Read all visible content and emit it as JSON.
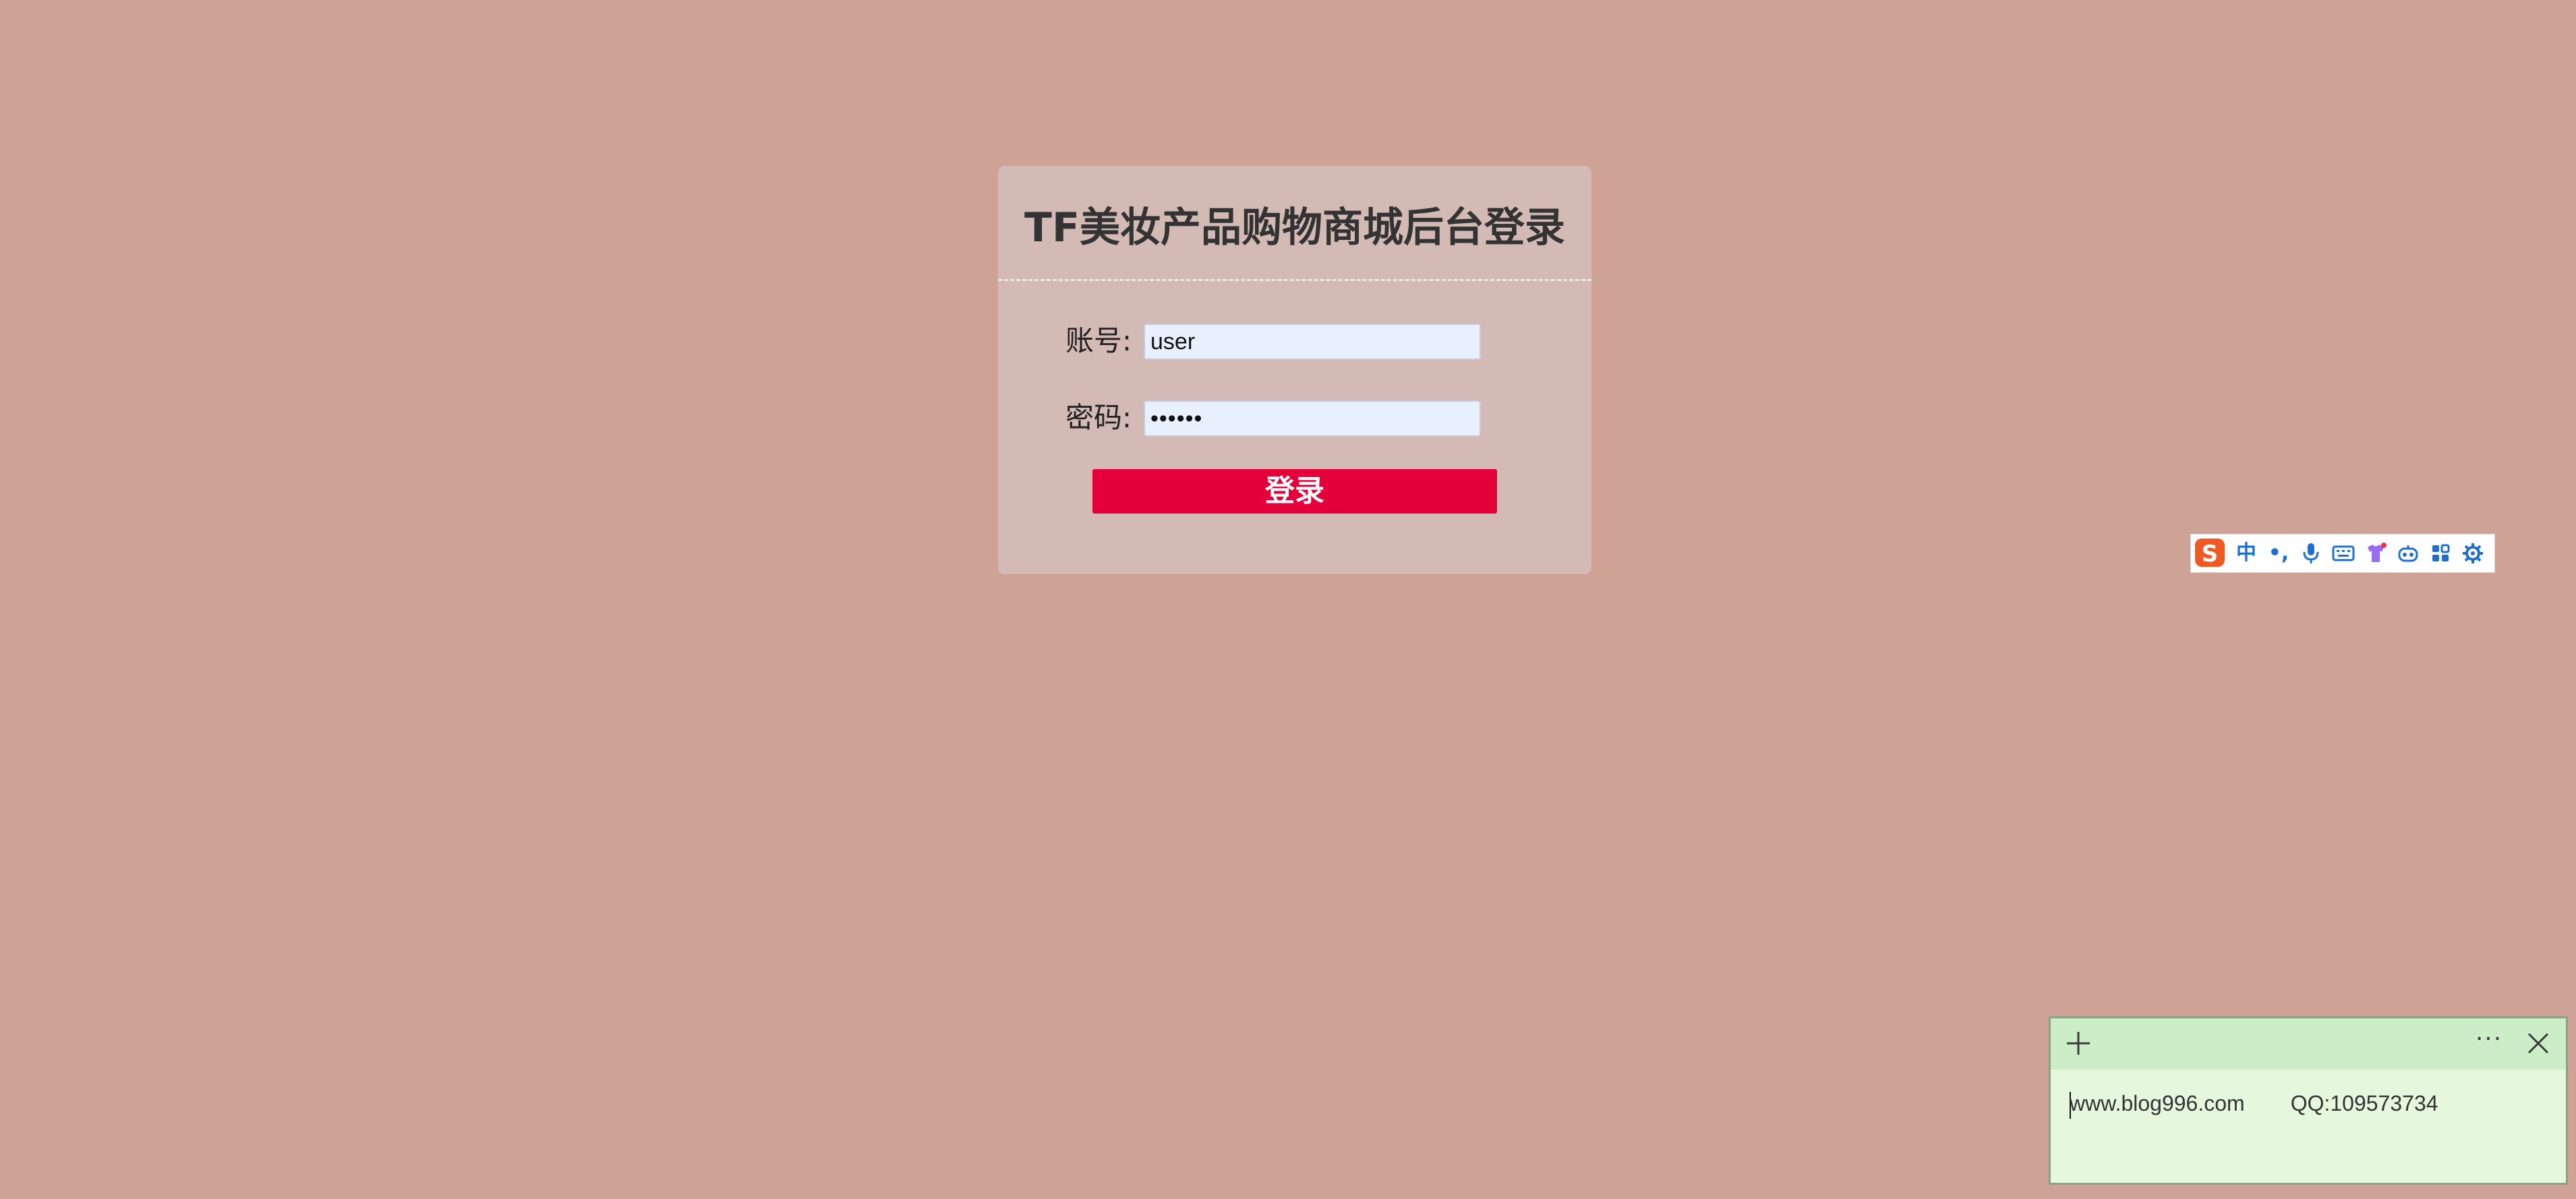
{
  "login": {
    "title": "TF美妆产品购物商城后台登录",
    "account_label": "账号:",
    "account_value": "user",
    "password_label": "密码:",
    "password_value": "••••••",
    "submit_label": "登录"
  },
  "ime_toolbar": {
    "logo": "S",
    "items": [
      {
        "icon": "chinese-mode-icon",
        "label": "中"
      },
      {
        "icon": "punctuation-icon",
        "label": "•,"
      },
      {
        "icon": "microphone-icon",
        "label": ""
      },
      {
        "icon": "keyboard-icon",
        "label": ""
      },
      {
        "icon": "skin-shirt-icon",
        "label": ""
      },
      {
        "icon": "robot-icon",
        "label": ""
      },
      {
        "icon": "apps-grid-icon",
        "label": ""
      },
      {
        "icon": "settings-icon",
        "label": ""
      }
    ]
  },
  "sticky_note": {
    "more_label": "···",
    "line_website": "www.blog996.com",
    "line_qq": "QQ:109573734"
  },
  "colors": {
    "background": "#cfa296",
    "card": "#d4bab4",
    "button": "#e4003a",
    "ime_accent": "#1f6fd1",
    "sticky_header": "#cbeec7",
    "sticky_body": "#e5f8de"
  }
}
